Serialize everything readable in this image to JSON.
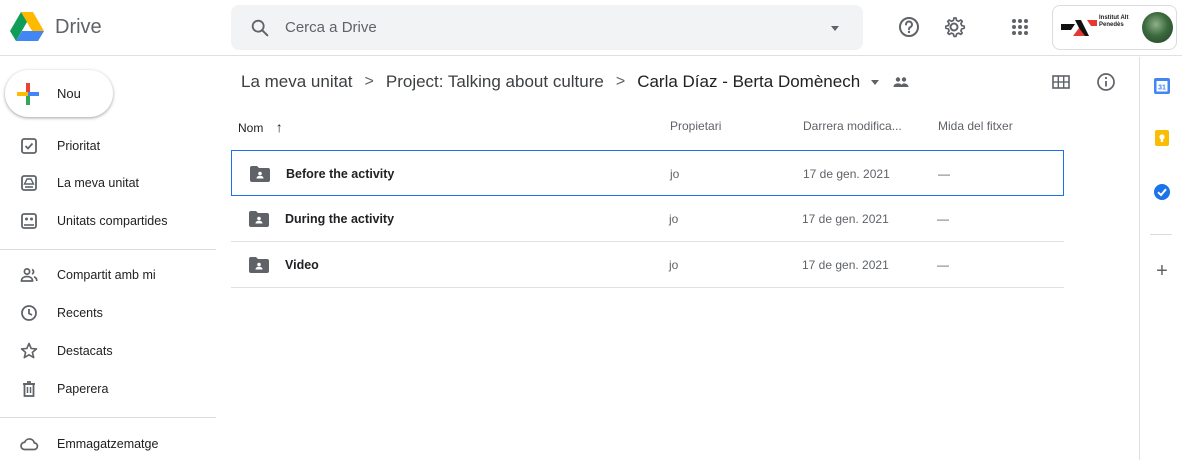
{
  "app": {
    "brand": "Drive"
  },
  "search": {
    "placeholder": "Cerca a Drive"
  },
  "account": {
    "org_name": "Institut Alt Penedès"
  },
  "sidebar": {
    "new_label": "Nou",
    "items": [
      {
        "label": "Prioritat"
      },
      {
        "label": "La meva unitat"
      },
      {
        "label": "Unitats compartides"
      },
      {
        "label": "Compartit amb mi"
      },
      {
        "label": "Recents"
      },
      {
        "label": "Destacats"
      },
      {
        "label": "Paperera"
      },
      {
        "label": "Emmagatzematge"
      }
    ]
  },
  "breadcrumb": {
    "root": "La meva unitat",
    "parent": "Project: Talking about culture",
    "current": "Carla Díaz - Berta Domènech",
    "separator": ">"
  },
  "columns": {
    "name": "Nom",
    "owner": "Propietari",
    "modified": "Darrera modifica...",
    "size": "Mida del fitxer",
    "sort_arrow": "↑"
  },
  "files": [
    {
      "name": "Before the activity",
      "owner": "jo",
      "modified": "17 de gen. 2021",
      "size": "—"
    },
    {
      "name": "During the activity",
      "owner": "jo",
      "modified": "17 de gen. 2021",
      "size": "—"
    },
    {
      "name": "Video",
      "owner": "jo",
      "modified": "17 de gen. 2021",
      "size": "—"
    }
  ],
  "rail": {
    "calendar_day": "31",
    "add": "+"
  },
  "colors": {
    "accent": "#1a73e8",
    "text": "#202124",
    "muted": "#5f6368",
    "border": "#e0e0e0"
  }
}
